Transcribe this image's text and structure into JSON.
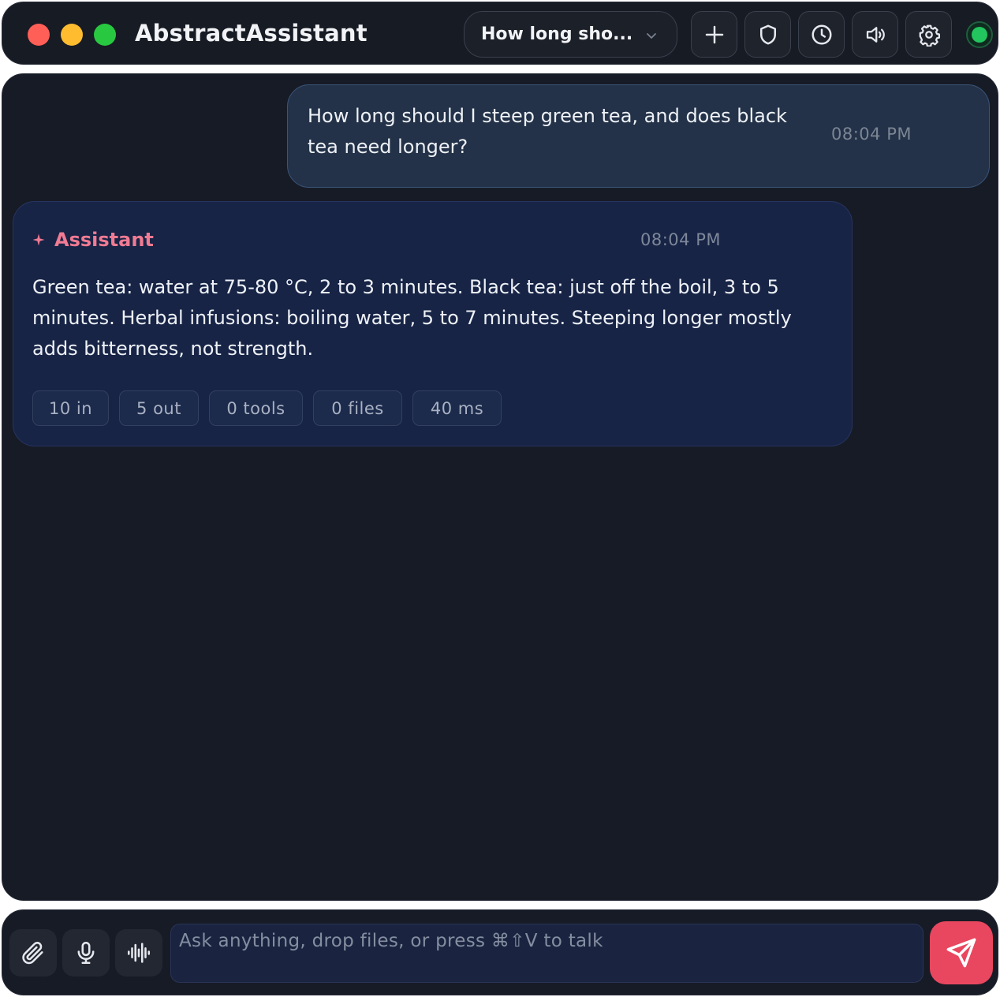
{
  "app": {
    "title": "AbstractAssistant",
    "conversation_select": {
      "selected": "How long sho..."
    },
    "toolbar": {
      "new_icon": "plus-icon",
      "privacy_icon": "shield-icon",
      "history_icon": "clock-icon",
      "voice_icon": "speaker-icon",
      "settings_icon": "gear-icon"
    },
    "status": {
      "color": "#22c55e"
    }
  },
  "messages": {
    "user": {
      "text": "How long should I steep green tea, and does black tea need longer?",
      "time": "08:04 PM"
    },
    "assistant": {
      "name": "Assistant",
      "time": "08:04 PM",
      "text": "Green tea: water at 75-80 °C, 2 to 3 minutes. Black tea: just off the boil, 3 to 5 minutes. Herbal infusions: boiling water, 5 to 7 minutes. Steeping longer mostly adds bitterness, not strength.",
      "chips": [
        "10 in",
        "5 out",
        "0 tools",
        "0 files",
        "40 ms"
      ]
    }
  },
  "composer": {
    "placeholder": "Ask anything, drop files, or press ⌘⇧V to talk",
    "value": "",
    "attach_icon": "paperclip-icon",
    "mic_icon": "microphone-icon",
    "voice_mode_icon": "waveform-icon",
    "send_icon": "send-icon"
  },
  "colors": {
    "accent": "#e9475f",
    "assistant_name": "#f07b93",
    "user_bubble": "#233248",
    "assistant_bubble": "#172446"
  }
}
